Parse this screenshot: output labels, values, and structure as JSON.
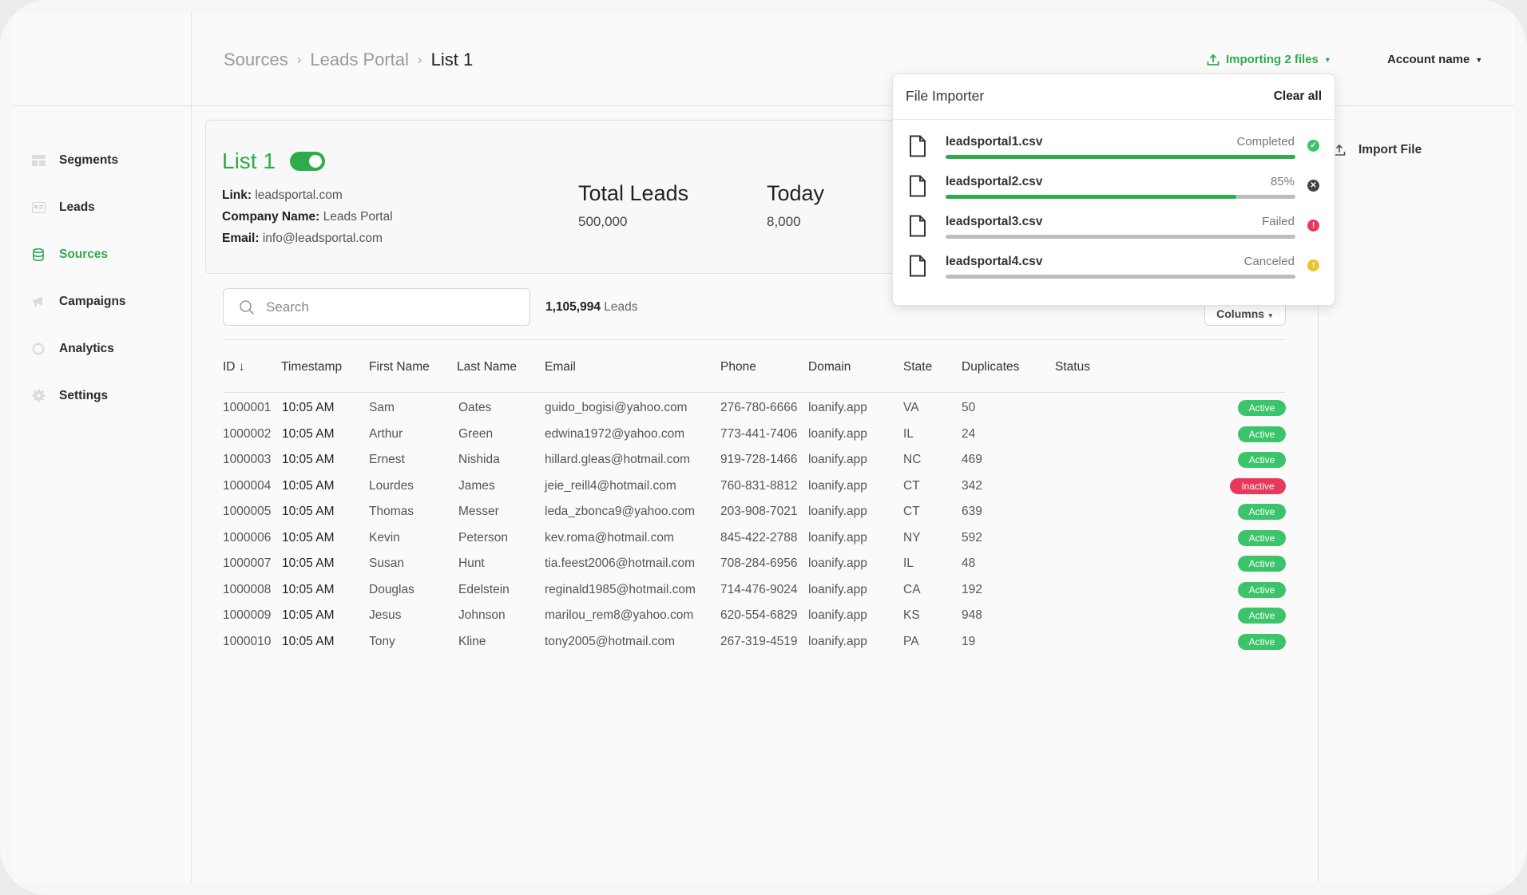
{
  "sidebar": {
    "items": [
      {
        "label": "Segments",
        "icon": "segments-icon"
      },
      {
        "label": "Leads",
        "icon": "leads-icon"
      },
      {
        "label": "Sources",
        "icon": "database-icon",
        "active": true
      },
      {
        "label": "Campaigns",
        "icon": "megaphone-icon"
      },
      {
        "label": "Analytics",
        "icon": "analytics-icon"
      },
      {
        "label": "Settings",
        "icon": "gear-icon"
      }
    ]
  },
  "header": {
    "breadcrumb": [
      "Sources",
      "Leads Portal",
      "List 1"
    ],
    "importing_label": "Importing 2 files",
    "account_label": "Account name"
  },
  "import_file_label": "Import File",
  "list": {
    "title": "List 1",
    "toggle_on": true,
    "link_label": "Link:",
    "link_value": "leadsportal.com",
    "company_label": "Company Name:",
    "company_value": "Leads Portal",
    "email_label": "Email:",
    "email_value": "info@leadsportal.com",
    "stats": [
      {
        "label": "Total Leads",
        "value": "500,000"
      },
      {
        "label": "Today",
        "value": "8,000"
      }
    ]
  },
  "search": {
    "placeholder": "Search",
    "count_bold": "1,105,994",
    "count_suffix": "Leads",
    "columns_label": "Columns"
  },
  "table": {
    "headers": [
      "ID ↓",
      "Timestamp",
      "First Name",
      "Last Name",
      "Email",
      "Phone",
      "Domain",
      "State",
      "Duplicates",
      "Status"
    ],
    "rows": [
      [
        "1000001",
        "10:05 AM",
        "Sam",
        "Oates",
        "guido_bogisi@yahoo.com",
        "276-780-6666",
        "loanify.app",
        "VA",
        "50",
        "Active"
      ],
      [
        "1000002",
        "10:05 AM",
        "Arthur",
        "Green",
        "edwina1972@yahoo.com",
        "773-441-7406",
        "loanify.app",
        "IL",
        "24",
        "Active"
      ],
      [
        "1000003",
        "10:05 AM",
        "Ernest",
        "Nishida",
        "hillard.gleas@hotmail.com",
        "919-728-1466",
        "loanify.app",
        "NC",
        "469",
        "Active"
      ],
      [
        "1000004",
        "10:05 AM",
        "Lourdes",
        "James",
        "jeie_reill4@hotmail.com",
        "760-831-8812",
        "loanify.app",
        "CT",
        "342",
        "Inactive"
      ],
      [
        "1000005",
        "10:05 AM",
        "Thomas",
        "Messer",
        "leda_zbonca9@yahoo.com",
        "203-908-7021",
        "loanify.app",
        "CT",
        "639",
        "Active"
      ],
      [
        "1000006",
        "10:05 AM",
        "Kevin",
        "Peterson",
        "kev.roma@hotmail.com",
        "845-422-2788",
        "loanify.app",
        "NY",
        "592",
        "Active"
      ],
      [
        "1000007",
        "10:05 AM",
        "Susan",
        "Hunt",
        "tia.feest2006@hotmail.com",
        "708-284-6956",
        "loanify.app",
        "IL",
        "48",
        "Active"
      ],
      [
        "1000008",
        "10:05 AM",
        "Douglas",
        "Edelstein",
        "reginald1985@hotmail.com",
        "714-476-9024",
        "loanify.app",
        "CA",
        "192",
        "Active"
      ],
      [
        "1000009",
        "10:05 AM",
        "Jesus",
        "Johnson",
        "marilou_rem8@yahoo.com",
        "620-554-6829",
        "loanify.app",
        "KS",
        "948",
        "Active"
      ],
      [
        "1000010",
        "10:05 AM",
        "Tony",
        "Kline",
        "tony2005@hotmail.com",
        "267-319-4519",
        "loanify.app",
        "PA",
        "19",
        "Active"
      ]
    ]
  },
  "importer": {
    "title": "File Importer",
    "clear_label": "Clear all",
    "files": [
      {
        "name": "leadsportal1.csv",
        "status": "Completed",
        "progress": 1.0,
        "state": "completed",
        "color": "#3cc46a"
      },
      {
        "name": "leadsportal2.csv",
        "status": "85%",
        "progress": 0.83,
        "state": "in-progress",
        "color": "#444444"
      },
      {
        "name": "leadsportal3.csv",
        "status": "Failed",
        "progress": 0,
        "state": "failed",
        "color": "#e8395a"
      },
      {
        "name": "leadsportal4.csv",
        "status": "Canceled",
        "progress": 0,
        "state": "canceled",
        "color": "#e8c52f"
      }
    ]
  },
  "colors": {
    "accent": "#2eab4a",
    "active_badge": "#3cc46a",
    "inactive_badge": "#e8395a"
  }
}
